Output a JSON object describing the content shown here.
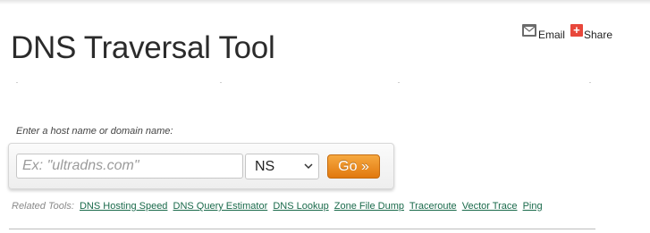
{
  "share_bar": {
    "email_label": "Email",
    "share_label": "Share",
    "share_icon_glyph": "+"
  },
  "page": {
    "title": "DNS Traversal Tool"
  },
  "form": {
    "label": "Enter a host name or domain name:",
    "host_input": {
      "placeholder": "Ex: \"ultradns.com\"",
      "value": ""
    },
    "record_type": {
      "selected": "NS"
    },
    "go_label": "Go »"
  },
  "related": {
    "label": "Related Tools:",
    "links": [
      "DNS Hosting Speed",
      "DNS Query Estimator",
      "DNS Lookup",
      "Zone File Dump",
      "Traceroute",
      "Vector Trace",
      "Ping"
    ]
  },
  "colors": {
    "go_button": "#e8861a",
    "share_icon": "#e8473b",
    "link": "#1a6a4b"
  }
}
